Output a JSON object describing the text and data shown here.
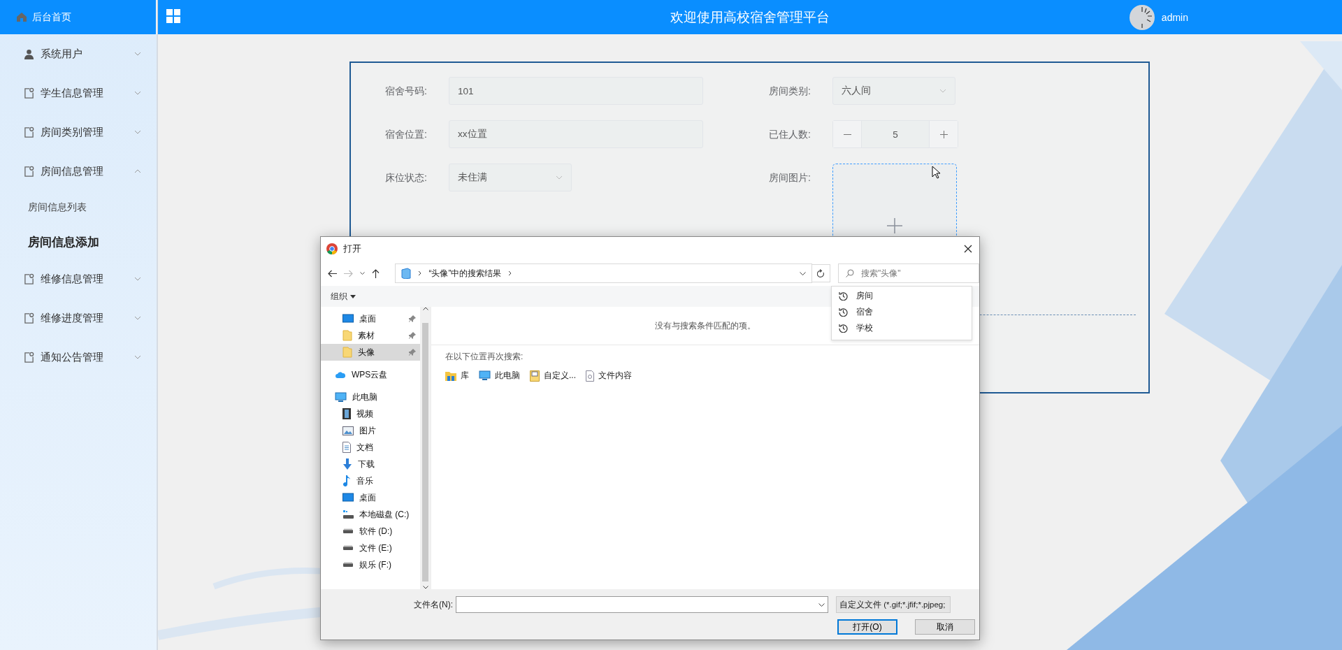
{
  "header": {
    "home": "后台首页",
    "title": "欢迎使用高校宿舍管理平台",
    "user": "admin"
  },
  "sidebar": {
    "items": [
      {
        "label": "系统用户",
        "kind": "user",
        "expanded": false
      },
      {
        "label": "学生信息管理",
        "kind": "doc",
        "expanded": false
      },
      {
        "label": "房间类别管理",
        "kind": "doc",
        "expanded": false
      },
      {
        "label": "房间信息管理",
        "kind": "doc",
        "expanded": true,
        "children": [
          {
            "label": "房间信息列表",
            "selected": false
          },
          {
            "label": "房间信息添加",
            "selected": true
          }
        ]
      },
      {
        "label": "维修信息管理",
        "kind": "doc",
        "expanded": false
      },
      {
        "label": "维修进度管理",
        "kind": "doc",
        "expanded": false
      },
      {
        "label": "通知公告管理",
        "kind": "doc",
        "expanded": false
      }
    ]
  },
  "form": {
    "fields": [
      {
        "label": "宿舍号码:",
        "kind": "input",
        "value": "101"
      },
      {
        "label": "房间类别:",
        "kind": "select",
        "value": "六人间"
      },
      {
        "label": "宿舍位置:",
        "kind": "input",
        "value": "xx位置"
      },
      {
        "label": "已住人数:",
        "kind": "number",
        "value": "5"
      },
      {
        "label": "床位状态:",
        "kind": "select",
        "value": "未住满"
      },
      {
        "label": "房间图片:",
        "kind": "upload"
      }
    ]
  },
  "dialog": {
    "title": "打开",
    "address": "“头像”中的搜索结果",
    "search": {
      "placeholder": "搜索\"头像\""
    },
    "suggestions": [
      "房间",
      "宿舍",
      "学校"
    ],
    "toolbar": "组织",
    "nav": [
      {
        "label": "桌面",
        "kind": "desktop",
        "pinned": true,
        "selected": false
      },
      {
        "label": "素材",
        "kind": "folder",
        "pinned": true,
        "selected": false
      },
      {
        "label": "头像",
        "kind": "folder",
        "pinned": true,
        "selected": true
      },
      {
        "label": "WPS云盘",
        "kind": "cloud",
        "pinned": false,
        "selected": false
      },
      {
        "label": "此电脑",
        "kind": "pc",
        "pinned": false,
        "selected": false,
        "children": [
          {
            "label": "视频",
            "kind": "video",
            "selected": false
          },
          {
            "label": "图片",
            "kind": "picture",
            "selected": false
          },
          {
            "label": "文档",
            "kind": "doc",
            "selected": false
          },
          {
            "label": "下载",
            "kind": "download",
            "selected": false
          },
          {
            "label": "音乐",
            "kind": "music",
            "selected": false
          },
          {
            "label": "桌面",
            "kind": "desktop",
            "selected": false
          },
          {
            "label": "本地磁盘 (C:)",
            "kind": "system-drive",
            "selected": false
          },
          {
            "label": "软件 (D:)",
            "kind": "drive",
            "selected": false
          },
          {
            "label": "文件 (E:)",
            "kind": "drive",
            "selected": false
          },
          {
            "label": "娱乐 (F:)",
            "kind": "drive",
            "selected": false
          }
        ]
      }
    ],
    "message": "没有与搜索条件匹配的项。",
    "search_again": "在以下位置再次搜索:",
    "locations": [
      {
        "label": "库",
        "kind": "library"
      },
      {
        "label": "此电脑",
        "kind": "pc"
      },
      {
        "label": "自定义...",
        "kind": "custom"
      },
      {
        "label": "文件内容",
        "kind": "file"
      }
    ],
    "filename_label": "文件名(N):",
    "filetype": "自定义文件 (*.gif;*.jfif;*.pjpeg;",
    "buttons": [
      {
        "label": "打开(O)",
        "default": true
      },
      {
        "label": "取消",
        "default": false
      }
    ]
  }
}
